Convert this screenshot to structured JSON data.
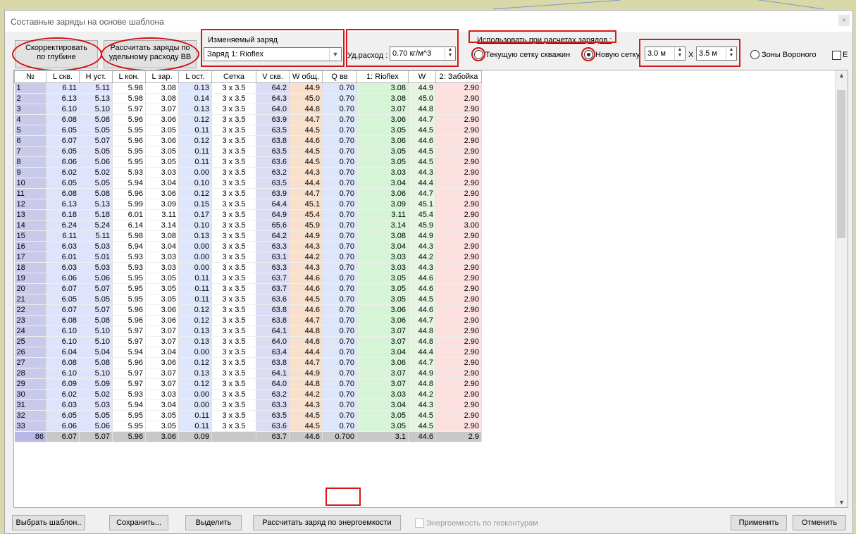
{
  "dialog": {
    "title": "Составные заряды на основе шаблона",
    "close_label": "×"
  },
  "toolbar": {
    "adjust_depth_label": "Скорректировать\nпо глубине",
    "calc_charges_label": "Рассчитать заряды по\nудельному расходу ВВ",
    "charge_group_label": "Изменяемый заряд",
    "charge_select_value": "Заряд 1: Rioflex",
    "specific_rate_label": "Уд.расход :",
    "specific_rate_value": "0.70 кг/м^3",
    "use_in_calc_label": "Использовать при расчетах зарядов :",
    "radio_current_grid": "Текущую сетку скважин",
    "radio_new_grid": "Новую сетку",
    "grid_x_value": "3.0 м",
    "grid_sep": "X",
    "grid_y_value": "3.5 м",
    "radio_voronoi": "Зоны Вороного",
    "checkbox_e": "E"
  },
  "table": {
    "headers": [
      "№",
      "L скв.",
      "H уст.",
      "L кон.",
      "L зар.",
      "L ост.",
      "Сетка",
      "V скв.",
      "W общ.",
      "Q вв",
      "1: Rioflex",
      "W",
      "2: Забойка"
    ],
    "rows": [
      [
        "1",
        "6.11",
        "5.11",
        "5.98",
        "3.08",
        "0.13",
        "3 x 3.5",
        "64.2",
        "44.9",
        "0.70",
        "3.08",
        "44.9",
        "2.90"
      ],
      [
        "2",
        "6.13",
        "5.13",
        "5.98",
        "3.08",
        "0.14",
        "3 x 3.5",
        "64.3",
        "45.0",
        "0.70",
        "3.08",
        "45.0",
        "2.90"
      ],
      [
        "3",
        "6.10",
        "5.10",
        "5.97",
        "3.07",
        "0.13",
        "3 x 3.5",
        "64.0",
        "44.8",
        "0.70",
        "3.07",
        "44.8",
        "2.90"
      ],
      [
        "4",
        "6.08",
        "5.08",
        "5.96",
        "3.06",
        "0.12",
        "3 x 3.5",
        "63.9",
        "44.7",
        "0.70",
        "3.06",
        "44.7",
        "2.90"
      ],
      [
        "5",
        "6.05",
        "5.05",
        "5.95",
        "3.05",
        "0.11",
        "3 x 3.5",
        "63.5",
        "44.5",
        "0.70",
        "3.05",
        "44.5",
        "2.90"
      ],
      [
        "6",
        "6.07",
        "5.07",
        "5.96",
        "3.06",
        "0.12",
        "3 x 3.5",
        "63.8",
        "44.6",
        "0.70",
        "3.06",
        "44.6",
        "2.90"
      ],
      [
        "7",
        "6.05",
        "5.05",
        "5.95",
        "3.05",
        "0.11",
        "3 x 3.5",
        "63.5",
        "44.5",
        "0.70",
        "3.05",
        "44.5",
        "2.90"
      ],
      [
        "8",
        "6.06",
        "5.06",
        "5.95",
        "3.05",
        "0.11",
        "3 x 3.5",
        "63.6",
        "44.5",
        "0.70",
        "3.05",
        "44.5",
        "2.90"
      ],
      [
        "9",
        "6.02",
        "5.02",
        "5.93",
        "3.03",
        "0.00",
        "3 x 3.5",
        "63.2",
        "44.3",
        "0.70",
        "3.03",
        "44.3",
        "2.90"
      ],
      [
        "10",
        "6.05",
        "5.05",
        "5.94",
        "3.04",
        "0.10",
        "3 x 3.5",
        "63.5",
        "44.4",
        "0.70",
        "3.04",
        "44.4",
        "2.90"
      ],
      [
        "11",
        "6.08",
        "5.08",
        "5.96",
        "3.06",
        "0.12",
        "3 x 3.5",
        "63.9",
        "44.7",
        "0.70",
        "3.06",
        "44.7",
        "2.90"
      ],
      [
        "12",
        "6.13",
        "5.13",
        "5.99",
        "3.09",
        "0.15",
        "3 x 3.5",
        "64.4",
        "45.1",
        "0.70",
        "3.09",
        "45.1",
        "2.90"
      ],
      [
        "13",
        "6.18",
        "5.18",
        "6.01",
        "3.11",
        "0.17",
        "3 x 3.5",
        "64.9",
        "45.4",
        "0.70",
        "3.11",
        "45.4",
        "2.90"
      ],
      [
        "14",
        "6.24",
        "5.24",
        "6.14",
        "3.14",
        "0.10",
        "3 x 3.5",
        "65.6",
        "45.9",
        "0.70",
        "3.14",
        "45.9",
        "3.00"
      ],
      [
        "15",
        "6.11",
        "5.11",
        "5.98",
        "3.08",
        "0.13",
        "3 x 3.5",
        "64.2",
        "44.9",
        "0.70",
        "3.08",
        "44.9",
        "2.90"
      ],
      [
        "16",
        "6.03",
        "5.03",
        "5.94",
        "3.04",
        "0.00",
        "3 x 3.5",
        "63.3",
        "44.3",
        "0.70",
        "3.04",
        "44.3",
        "2.90"
      ],
      [
        "17",
        "6.01",
        "5.01",
        "5.93",
        "3.03",
        "0.00",
        "3 x 3.5",
        "63.1",
        "44.2",
        "0.70",
        "3.03",
        "44.2",
        "2.90"
      ],
      [
        "18",
        "6.03",
        "5.03",
        "5.93",
        "3.03",
        "0.00",
        "3 x 3.5",
        "63.3",
        "44.3",
        "0.70",
        "3.03",
        "44.3",
        "2.90"
      ],
      [
        "19",
        "6.06",
        "5.06",
        "5.95",
        "3.05",
        "0.11",
        "3 x 3.5",
        "63.7",
        "44.6",
        "0.70",
        "3.05",
        "44.6",
        "2.90"
      ],
      [
        "20",
        "6.07",
        "5.07",
        "5.95",
        "3.05",
        "0.11",
        "3 x 3.5",
        "63.7",
        "44.6",
        "0.70",
        "3.05",
        "44.6",
        "2.90"
      ],
      [
        "21",
        "6.05",
        "5.05",
        "5.95",
        "3.05",
        "0.11",
        "3 x 3.5",
        "63.6",
        "44.5",
        "0.70",
        "3.05",
        "44.5",
        "2.90"
      ],
      [
        "22",
        "6.07",
        "5.07",
        "5.96",
        "3.06",
        "0.12",
        "3 x 3.5",
        "63.8",
        "44.6",
        "0.70",
        "3.06",
        "44.6",
        "2.90"
      ],
      [
        "23",
        "6.08",
        "5.08",
        "5.96",
        "3.06",
        "0.12",
        "3 x 3.5",
        "63.8",
        "44.7",
        "0.70",
        "3.06",
        "44.7",
        "2.90"
      ],
      [
        "24",
        "6.10",
        "5.10",
        "5.97",
        "3.07",
        "0.13",
        "3 x 3.5",
        "64.1",
        "44.8",
        "0.70",
        "3.07",
        "44.8",
        "2.90"
      ],
      [
        "25",
        "6.10",
        "5.10",
        "5.97",
        "3.07",
        "0.13",
        "3 x 3.5",
        "64.0",
        "44.8",
        "0.70",
        "3.07",
        "44.8",
        "2.90"
      ],
      [
        "26",
        "6.04",
        "5.04",
        "5.94",
        "3.04",
        "0.00",
        "3 x 3.5",
        "63.4",
        "44.4",
        "0.70",
        "3.04",
        "44.4",
        "2.90"
      ],
      [
        "27",
        "6.08",
        "5.08",
        "5.96",
        "3.06",
        "0.12",
        "3 x 3.5",
        "63.8",
        "44.7",
        "0.70",
        "3.06",
        "44.7",
        "2.90"
      ],
      [
        "28",
        "6.10",
        "5.10",
        "5.97",
        "3.07",
        "0.13",
        "3 x 3.5",
        "64.1",
        "44.9",
        "0.70",
        "3.07",
        "44.9",
        "2.90"
      ],
      [
        "29",
        "6.09",
        "5.09",
        "5.97",
        "3.07",
        "0.12",
        "3 x 3.5",
        "64.0",
        "44.8",
        "0.70",
        "3.07",
        "44.8",
        "2.90"
      ],
      [
        "30",
        "6.02",
        "5.02",
        "5.93",
        "3.03",
        "0.00",
        "3 x 3.5",
        "63.2",
        "44.2",
        "0.70",
        "3.03",
        "44.2",
        "2.90"
      ],
      [
        "31",
        "6.03",
        "5.03",
        "5.94",
        "3.04",
        "0.00",
        "3 x 3.5",
        "63.3",
        "44.3",
        "0.70",
        "3.04",
        "44.3",
        "2.90"
      ],
      [
        "32",
        "6.05",
        "5.05",
        "5.95",
        "3.05",
        "0.11",
        "3 x 3.5",
        "63.5",
        "44.5",
        "0.70",
        "3.05",
        "44.5",
        "2.90"
      ],
      [
        "33",
        "6.06",
        "5.06",
        "5.95",
        "3.05",
        "0.11",
        "3 x 3.5",
        "63.6",
        "44.5",
        "0.70",
        "3.05",
        "44.5",
        "2.90"
      ]
    ],
    "total": [
      "86",
      "6.07",
      "5.07",
      "5.96",
      "3.06",
      "0.09",
      "",
      "63.7",
      "44.6",
      "0.700",
      "3.1",
      "44.6",
      "2.9"
    ]
  },
  "footer": {
    "choose_template_label": "Выбрать шаблон..",
    "save_label": "Сохранить...",
    "select_label": "Выделить",
    "calc_energy_label": "Рассчитать заряд по энергоемкости",
    "energy_contours_label": "Энергоемкость по геоконтурам",
    "apply_label": "Применить",
    "cancel_label": "Отменить"
  },
  "colors": {
    "highlight_red": "#d81818",
    "col_no": "#c9c9ea",
    "col_blue": "#dfe3fb",
    "col_peach": "#f8e0cc",
    "col_green": "#d6f5d6",
    "col_pink": "#fde0e0"
  }
}
